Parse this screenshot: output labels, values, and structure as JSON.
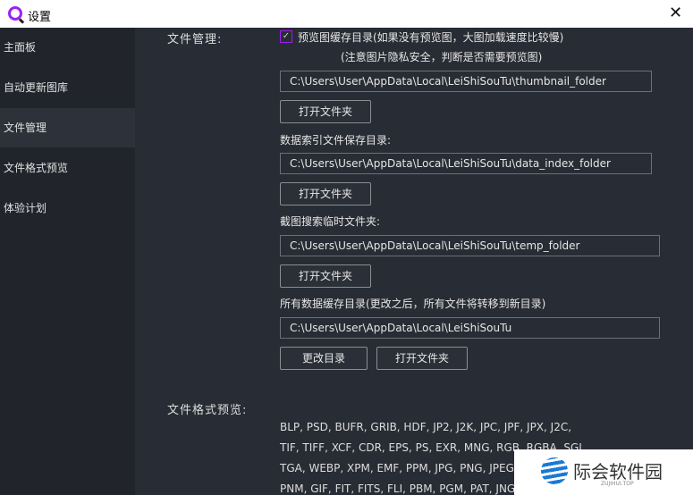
{
  "window": {
    "title": "设置",
    "icon": "app-logo-icon",
    "close": "✕"
  },
  "sidebar": {
    "items": [
      {
        "label": "主面板"
      },
      {
        "label": "自动更新图库"
      },
      {
        "label": "文件管理",
        "active": true
      },
      {
        "label": "文件格式预览"
      },
      {
        "label": "体验计划"
      }
    ]
  },
  "file_mgmt": {
    "section_label": "文件管理:",
    "thumb_checkbox": {
      "label": "预览图缓存目录(如果没有预览图，大图加载速度比较慢)",
      "checked": true,
      "check": "✓"
    },
    "thumb_note": "(注意图片隐私安全，判断是否需要预览图)",
    "thumb_path": "C:\\Users\\User\\AppData\\Local\\LeiShiSouTu\\thumbnail_folder",
    "open_folder": "打开文件夹",
    "index_label": "数据索引文件保存目录:",
    "index_path": "C:\\Users\\User\\AppData\\Local\\LeiShiSouTu\\data_index_folder",
    "temp_label": "截图搜索临时文件夹:",
    "temp_path": "C:\\Users\\User\\AppData\\Local\\LeiShiSouTu\\temp_folder",
    "cache_label": "所有数据缓存目录(更改之后，所有文件将转移到新目录)",
    "cache_path": "C:\\Users\\User\\AppData\\Local\\LeiShiSouTu",
    "change_dir": "更改目录"
  },
  "formats": {
    "section_label": "文件格式预览:",
    "lines": [
      "BLP, PSD, BUFR, GRIB, HDF, JP2, J2K, JPC, JPF, JPX, J2C,",
      "TIF, TIFF, XCF, CDR, EPS, PS, EXR, MNG, RGB, RGBA, SGI,",
      "TGA, WEBP, XPM, EMF, PPM, JPG, PNG, JPEG,",
      "PNM, GIF, FIT, FITS, FLI, PBM, PGM, PAT, JNG"
    ]
  },
  "watermark": {
    "name": "际会软件园",
    "sub": "ZUJIHUI.TOP"
  },
  "colors": {
    "accent": "#a020f0",
    "sidebar_bg": "#21252b",
    "main_bg": "#282c34"
  }
}
